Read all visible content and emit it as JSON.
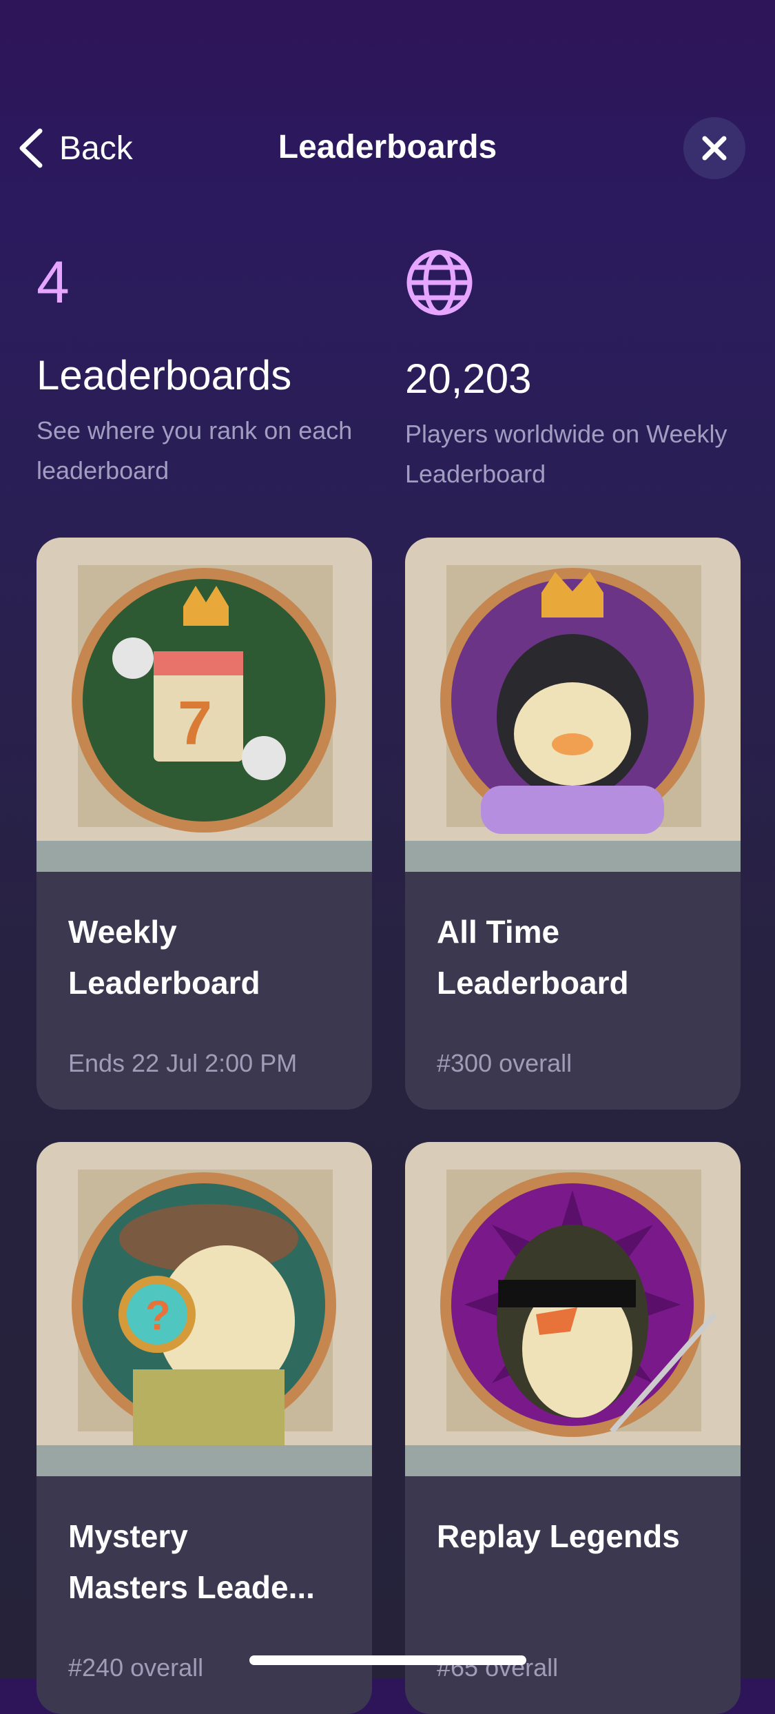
{
  "nav": {
    "back_label": "Back",
    "title": "Leaderboards"
  },
  "stats": {
    "left": {
      "number": "4",
      "heading": "Leaderboards",
      "subtitle": "See where you rank on each leaderboard"
    },
    "right": {
      "icon": "globe-icon",
      "heading": "20,203",
      "subtitle": "Players worldwide on Weekly Leaderboard"
    }
  },
  "cards": [
    {
      "title_line1": "Weekly",
      "title_line2": "Leaderboard",
      "subtitle": "Ends 22 Jul 2:00 PM",
      "badge": "calendar-crown",
      "color": "#2e5a33"
    },
    {
      "title_line1": "All Time",
      "title_line2": "Leaderboard",
      "subtitle": "#300 overall",
      "badge": "penguin-king",
      "color": "#6b3486"
    },
    {
      "title_line1": "Mystery",
      "title_line2": "Masters Leade...",
      "subtitle": "#240 overall",
      "badge": "penguin-detective",
      "color": "#2e6a5e"
    },
    {
      "title_line1": "Replay Legends",
      "title_line2": "",
      "subtitle": "#65 overall",
      "badge": "penguin-sunglasses",
      "color": "#7a1a8a"
    }
  ],
  "colors": {
    "accent": "#e6a6ff",
    "card_bg": "#3b3850",
    "muted_text": "#a29ec1"
  }
}
